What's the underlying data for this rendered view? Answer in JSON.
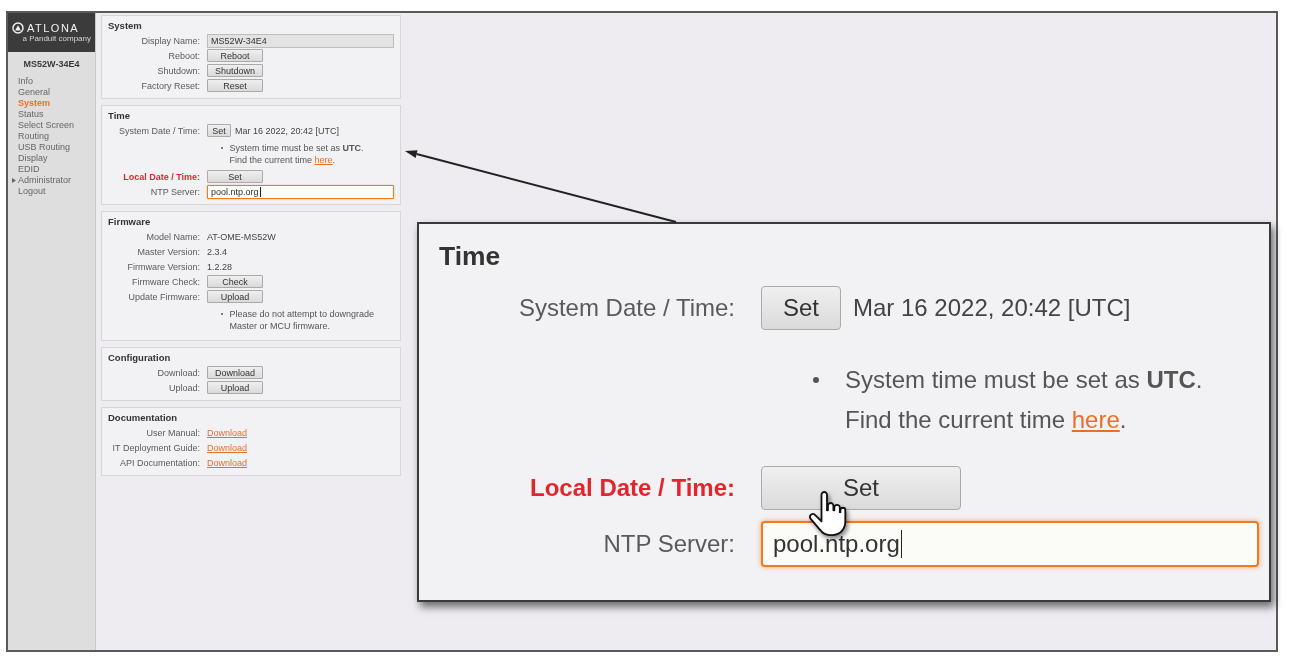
{
  "sidebar": {
    "logo": {
      "wordmark": "ATLONA",
      "tagline": "a Panduit company"
    },
    "device_name": "MS52W-34E4",
    "items": [
      {
        "label": "Info",
        "kind": "link",
        "selected": false
      },
      {
        "label": "General",
        "kind": "link",
        "selected": false
      },
      {
        "label": "System",
        "kind": "link",
        "selected": true
      },
      {
        "label": "Status",
        "kind": "link",
        "selected": false
      },
      {
        "label": "Select Screen",
        "kind": "link",
        "selected": false
      },
      {
        "label": "Routing",
        "kind": "link",
        "selected": false
      },
      {
        "label": "USB Routing",
        "kind": "link",
        "selected": false
      },
      {
        "label": "Display",
        "kind": "link",
        "selected": false
      },
      {
        "label": "EDID",
        "kind": "link",
        "selected": false
      },
      {
        "label": "Administrator",
        "kind": "group",
        "selected": false
      },
      {
        "label": "Logout",
        "kind": "link",
        "selected": false
      }
    ]
  },
  "panels": [
    {
      "title": "System",
      "rows": [
        {
          "kind": "field",
          "label": "Display Name:",
          "value": "MS52W-34E4",
          "focused": false,
          "highlighted": false
        },
        {
          "kind": "button",
          "label": "Reboot:",
          "button": "Reboot",
          "highlighted": false
        },
        {
          "kind": "button",
          "label": "Shutdown:",
          "button": "Shutdown",
          "highlighted": false
        },
        {
          "kind": "button",
          "label": "Factory Reset:",
          "button": "Reset",
          "highlighted": false
        }
      ]
    },
    {
      "title": "Time",
      "rows": [
        {
          "kind": "button_text",
          "label": "System Date / Time:",
          "button": "Set",
          "value": "Mar 16 2022, 20:42 [UTC]",
          "highlighted": false
        },
        {
          "kind": "note",
          "text": "System time must be set as **UTC**. Find the current time ",
          "link": "here",
          "end": "."
        },
        {
          "kind": "button",
          "label": "Local Date / Time:",
          "button": "Set",
          "highlighted": true
        },
        {
          "kind": "field",
          "label": "NTP Server:",
          "value": "pool.ntp.org",
          "focused": true,
          "highlighted": false
        }
      ]
    },
    {
      "title": "Firmware",
      "rows": [
        {
          "kind": "text",
          "label": "Model Name:",
          "value": "AT-OME-MS52W",
          "highlighted": false
        },
        {
          "kind": "text",
          "label": "Master Version:",
          "value": "2.3.4",
          "highlighted": false
        },
        {
          "kind": "text",
          "label": "Firmware Version:",
          "value": "1.2.28",
          "highlighted": false
        },
        {
          "kind": "button",
          "label": "Firmware Check:",
          "button": "Check",
          "highlighted": false
        },
        {
          "kind": "button",
          "label": "Update Firmware:",
          "button": "Upload",
          "highlighted": false
        },
        {
          "kind": "note",
          "text": "Please do not attempt to downgrade Master or MCU firmware."
        }
      ]
    },
    {
      "title": "Configuration",
      "rows": [
        {
          "kind": "button",
          "label": "Download:",
          "button": "Download",
          "highlighted": false
        },
        {
          "kind": "button",
          "label": "Upload:",
          "button": "Upload",
          "highlighted": false
        }
      ]
    },
    {
      "title": "Documentation",
      "rows": [
        {
          "kind": "link",
          "label": "User Manual:",
          "link": "Download",
          "highlighted": false
        },
        {
          "kind": "link",
          "label": "IT Deployment Guide:",
          "link": "Download",
          "highlighted": false
        },
        {
          "kind": "link",
          "label": "API Documentation:",
          "link": "Download",
          "highlighted": false
        }
      ]
    }
  ],
  "callout": {
    "title": "Time",
    "rows": [
      {
        "kind": "button_text",
        "label": "System Date / Time:",
        "button": "Set",
        "value": "Mar 16 2022, 20:42 [UTC]",
        "highlighted": false
      },
      {
        "kind": "note",
        "text": "System time must be set as **UTC**. Find the current time ",
        "link": "here",
        "end": "."
      },
      {
        "kind": "button",
        "label": "Local Date / Time:",
        "button": "Set",
        "highlighted": true
      },
      {
        "kind": "field",
        "label": "NTP Server:",
        "value": "pool.ntp.org",
        "focused": true,
        "highlighted": false
      }
    ]
  }
}
